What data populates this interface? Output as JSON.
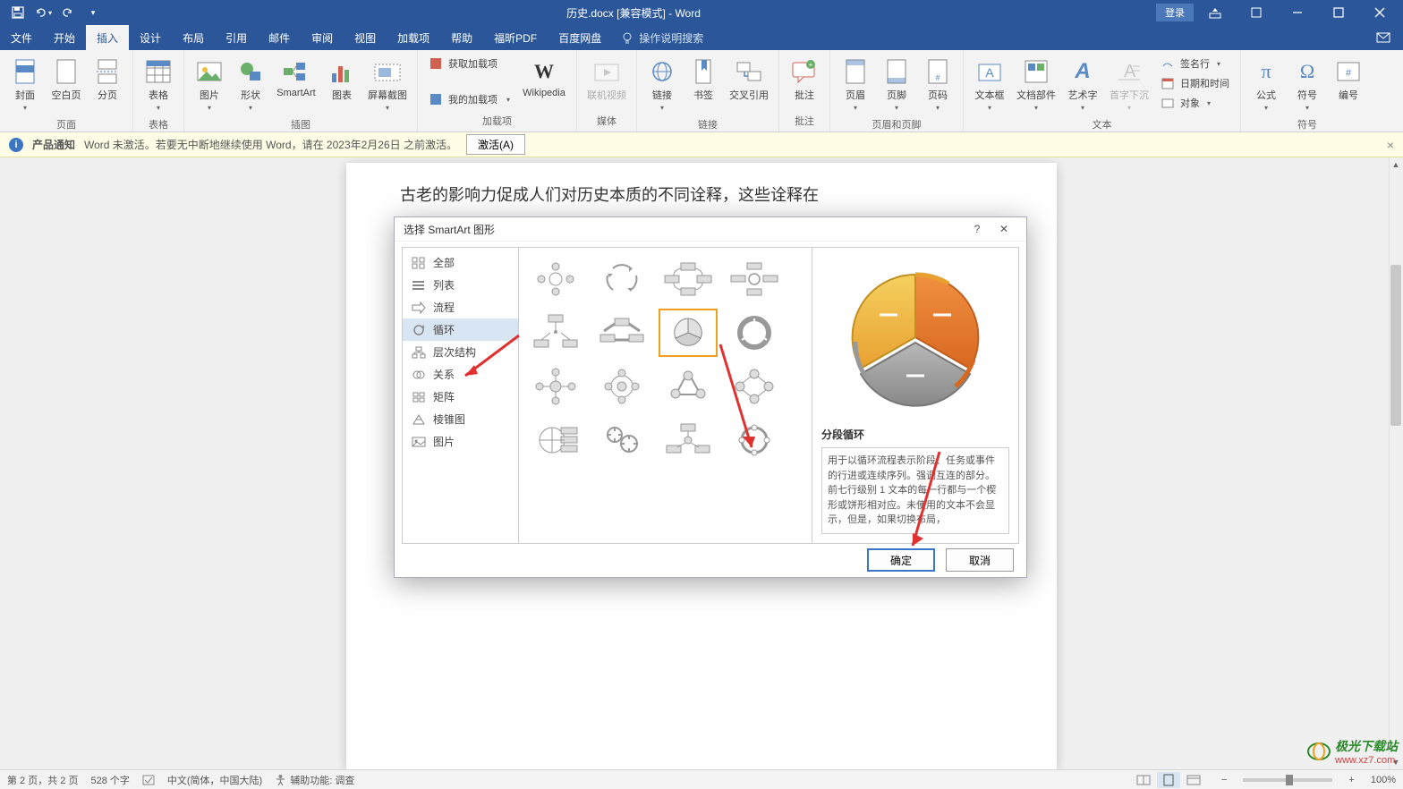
{
  "title": "历史.docx [兼容模式] - Word",
  "login": "登录",
  "tabs": [
    "文件",
    "开始",
    "插入",
    "设计",
    "布局",
    "引用",
    "邮件",
    "审阅",
    "视图",
    "加载项",
    "帮助",
    "福昕PDF",
    "百度网盘"
  ],
  "active_tab": 2,
  "tellme": "操作说明搜索",
  "ribbon": {
    "groups": [
      {
        "label": "页面",
        "items": [
          {
            "l": "封面",
            "t": "cover"
          },
          {
            "l": "空白页",
            "t": "blank"
          },
          {
            "l": "分页",
            "t": "break"
          }
        ]
      },
      {
        "label": "表格",
        "items": [
          {
            "l": "表格",
            "t": "table"
          }
        ]
      },
      {
        "label": "插图",
        "items": [
          {
            "l": "图片",
            "t": "pic"
          },
          {
            "l": "形状",
            "t": "shapes"
          },
          {
            "l": "SmartArt",
            "t": "smartart"
          },
          {
            "l": "图表",
            "t": "chart"
          },
          {
            "l": "屏幕截图",
            "t": "screenshot"
          }
        ]
      },
      {
        "label": "加载项",
        "small": [
          {
            "l": "获取加载项",
            "t": "getaddin"
          },
          {
            "l": "我的加载项",
            "t": "myaddin"
          }
        ],
        "items": [
          {
            "l": "Wikipedia",
            "t": "wiki"
          }
        ]
      },
      {
        "label": "媒体",
        "items": [
          {
            "l": "联机视频",
            "t": "video",
            "disabled": true
          }
        ]
      },
      {
        "label": "链接",
        "items": [
          {
            "l": "链接",
            "t": "link"
          },
          {
            "l": "书签",
            "t": "bookmark"
          },
          {
            "l": "交叉引用",
            "t": "crossref"
          }
        ]
      },
      {
        "label": "批注",
        "items": [
          {
            "l": "批注",
            "t": "comment"
          }
        ]
      },
      {
        "label": "页眉和页脚",
        "items": [
          {
            "l": "页眉",
            "t": "header"
          },
          {
            "l": "页脚",
            "t": "footer"
          },
          {
            "l": "页码",
            "t": "pagenum"
          }
        ]
      },
      {
        "label": "文本",
        "items": [
          {
            "l": "文本框",
            "t": "textbox"
          },
          {
            "l": "文档部件",
            "t": "quickparts"
          },
          {
            "l": "艺术字",
            "t": "wordart"
          },
          {
            "l": "首字下沉",
            "t": "dropcap",
            "disabled": true
          }
        ],
        "small": [
          {
            "l": "签名行",
            "t": "sig"
          },
          {
            "l": "日期和时间",
            "t": "date"
          },
          {
            "l": "对象",
            "t": "object"
          }
        ]
      },
      {
        "label": "符号",
        "items": [
          {
            "l": "公式",
            "t": "equation"
          },
          {
            "l": "符号",
            "t": "symbol"
          },
          {
            "l": "编号",
            "t": "number"
          }
        ]
      }
    ]
  },
  "msgbar": {
    "label": "产品通知",
    "text": "Word 未激活。若要无中断地继续使用 Word，请在 2023年2月26日 之前激活。",
    "button": "激活(A)"
  },
  "doc_text": "古老的影响力促成人们对历史本质的不同诠释，这些诠释在",
  "dialog": {
    "title": "选择 SmartArt 图形",
    "categories": [
      "全部",
      "列表",
      "流程",
      "循环",
      "层次结构",
      "关系",
      "矩阵",
      "棱锥图",
      "图片"
    ],
    "selected_category": 3,
    "selected_item": 6,
    "preview_title": "分段循环",
    "preview_desc": "用于以循环流程表示阶段、任务或事件的行进或连续序列。强调互连的部分。前七行级别 1 文本的每一行都与一个楔形或饼形相对应。未使用的文本不会显示，但是，如果切换布局，",
    "ok": "确定",
    "cancel": "取消"
  },
  "statusbar": {
    "page": "第 2 页，共 2 页",
    "words": "528 个字",
    "lang": "中文(简体，中国大陆)",
    "a11y": "辅助功能: 调查",
    "zoom": "100%"
  },
  "watermark": {
    "name": "极光下载站",
    "url": "www.xz7.com"
  }
}
